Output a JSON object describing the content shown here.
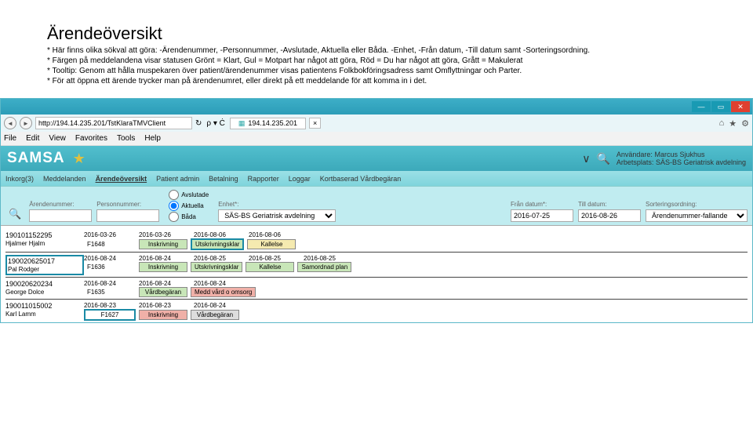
{
  "doc": {
    "title": "Ärendeöversikt",
    "lines": [
      "* Här finns olika sökval att göra: -Ärendenummer, -Personnummer, -Avslutade, Aktuella eller Båda. -Enhet, -Från datum, -Till datum samt -Sorteringsordning.",
      "* Färgen på meddelandena visar statusen Grönt = Klart, Gul = Motpart har något att göra, Röd = Du har något att göra, Grått = Makulerat",
      "* Tooltip: Genom att hålla muspekaren över patient/ärendenummer visas patientens Folkbokföringsadress samt Omflyttningar och Parter.",
      "* För att öppna ett ärende trycker man på ärendenumret, eller direkt på ett meddelande för att komma in i det."
    ]
  },
  "browser": {
    "url": "http://194.14.235.201/TstKlaraTMVClient",
    "tab": "194.14.235.201",
    "menus": [
      "File",
      "Edit",
      "View",
      "Favorites",
      "Tools",
      "Help"
    ]
  },
  "app": {
    "brand": "SAMSA",
    "user_lbl": "Användare:",
    "user": "Marcus Sjukhus",
    "wp_lbl": "Arbetsplats:",
    "wp": "SÄS-BS Geriatrisk avdelning",
    "mainmenu": [
      "Inkorg(3)",
      "Meddelanden",
      "Ärendeöversikt",
      "Patient admin",
      "Betalning",
      "Rapporter",
      "Loggar",
      "Kortbaserad Vårdbegäran"
    ],
    "active_menu": 2
  },
  "filters": {
    "arende_lbl": "Ärendenummer:",
    "person_lbl": "Personnummer:",
    "radio": [
      "Avslutade",
      "Aktuella",
      "Båda"
    ],
    "radio_sel": 1,
    "enhet_lbl": "Enhet*:",
    "enhet": "SÄS-BS Geriatrisk avdelning",
    "fran_lbl": "Från datum*:",
    "fran": "2016-07-25",
    "till_lbl": "Till datum:",
    "till": "2016-08-26",
    "sort_lbl": "Sorteringsordning:",
    "sort": "Ärendenummer-fallande"
  },
  "cases": [
    {
      "pnr": "190101152295",
      "name": "Hjalmer Hjalm",
      "boxed": false,
      "dates": [
        "2016-03-26",
        "2016-03-26",
        "2016-08-06",
        "2016-08-06"
      ],
      "fnum": "F1648",
      "tags": [
        [
          "Inskrivning",
          "green",
          0
        ],
        [
          "Utskrivningsklar",
          "green",
          1
        ],
        [
          "Kallelse",
          "yellow",
          0
        ]
      ]
    },
    {
      "pnr": "190020625017",
      "name": "Pal Rodger",
      "boxed": true,
      "dates": [
        "2016-08-24",
        "2016-08-24",
        "2016-08-25",
        "2016-08-25",
        "2016-08-25"
      ],
      "fnum": "F1636",
      "tags": [
        [
          "Inskrivning",
          "green",
          0
        ],
        [
          "Utskrivningsklar",
          "green",
          0
        ],
        [
          "Kallelse",
          "green",
          0
        ],
        [
          "Samordnad plan",
          "green",
          0
        ]
      ]
    },
    {
      "pnr": "190020620234",
      "name": "George Dolce",
      "boxed": false,
      "dates": [
        "2016-08-24",
        "2016-08-24",
        "2016-08-24"
      ],
      "fnum": "F1635",
      "tags": [
        [
          "Vårdbegäran",
          "green",
          0
        ],
        [
          "Medd vård o omsorg",
          "red",
          0
        ]
      ]
    },
    {
      "pnr": "190011015002",
      "name": "Karl Lamm",
      "boxed": false,
      "dates": [
        "2016-08-23",
        "2016-08-23",
        "2016-08-24"
      ],
      "fnum": "F1627",
      "tags": [
        [
          "Inskrivning",
          "red",
          0
        ],
        [
          "Vårdbegäran",
          "gray",
          0
        ]
      ],
      "fboxed": true
    }
  ],
  "taglbl": {
    "Inskrivning": "Inskrivning",
    "Utskrivningsklar": "Utskrivningsklar",
    "Kallelse": "Kallelse",
    "Samordnad plan": "Samordnad plan",
    "Vårdbegäran": "Vårdbegäran",
    "Medd vård o omsorg": "Medd vård o omsorg"
  }
}
